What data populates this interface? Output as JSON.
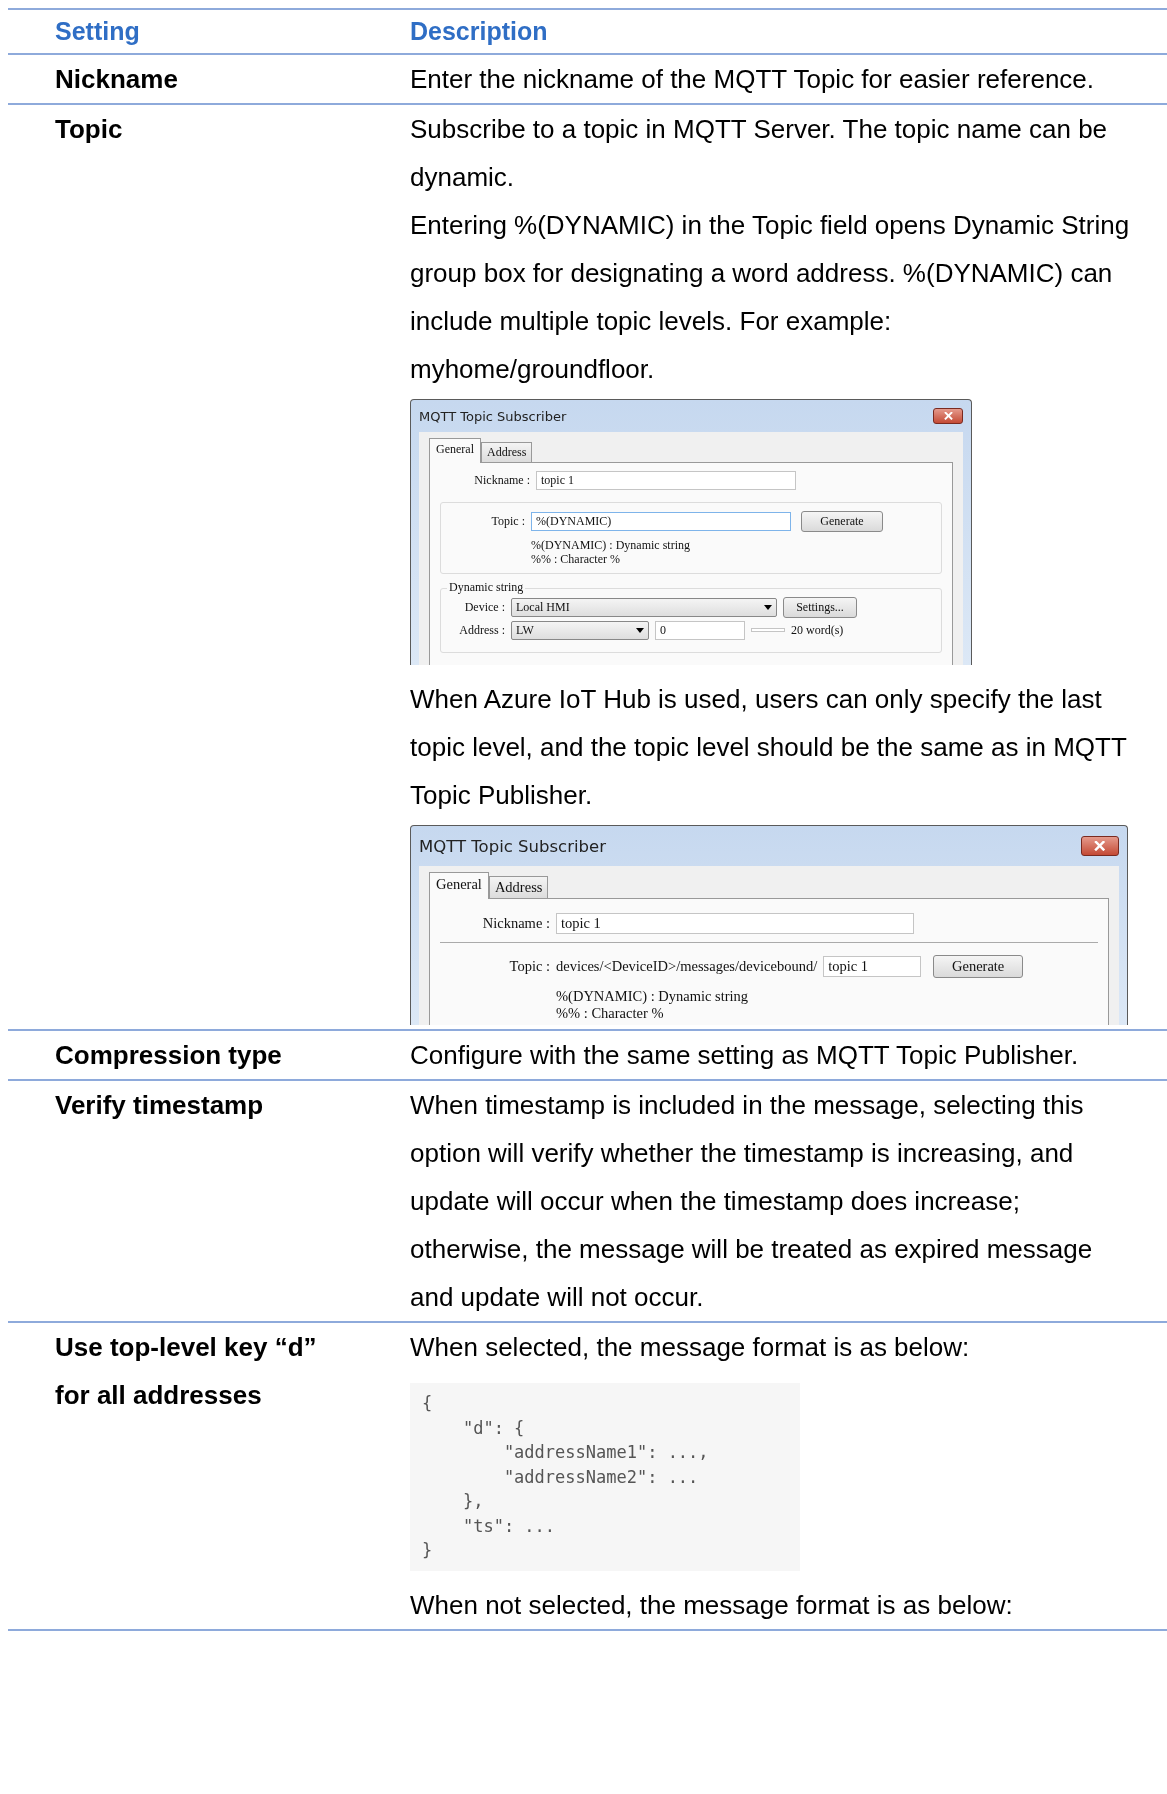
{
  "table": {
    "columns": [
      "Setting",
      "Description"
    ],
    "rows": [
      {
        "setting": "Nickname",
        "content": [
          {
            "kind": "text",
            "text": "Enter the nickname of the MQTT Topic for easier reference."
          }
        ]
      },
      {
        "setting": "Topic",
        "content": [
          {
            "kind": "text",
            "text": "Subscribe to a topic in MQTT Server. The topic name can be dynamic."
          },
          {
            "kind": "text",
            "text": "Entering %(DYNAMIC) in the Topic field opens Dynamic String group box for designating a word address. %(DYNAMIC) can include multiple topic levels. For example: myhome/groundfloor."
          },
          {
            "kind": "dialog",
            "title": "MQTT Topic Subscriber",
            "tabs": [
              {
                "label": "General",
                "selected": true
              },
              {
                "label": "Address",
                "selected": false
              }
            ],
            "nickname_label": "Nickname :",
            "nickname_value": "topic 1",
            "topic_label": "Topic :",
            "topic_value": "%(DYNAMIC)",
            "generate_button": "Generate",
            "hints": [
              "%(DYNAMIC) : Dynamic string",
              "%% : Character %"
            ],
            "dynamic_string": {
              "title": "Dynamic string",
              "device_label": "Device :",
              "device_value": "Local HMI",
              "settings_button": "Settings...",
              "address_label": "Address :",
              "address_type": "LW",
              "address_value": "0",
              "word_count": "20 word(s)"
            }
          },
          {
            "kind": "text",
            "text": "When Azure IoT Hub is used, users can only specify the last topic level, and the topic level should be the same as in MQTT Topic Publisher."
          },
          {
            "kind": "dialog",
            "title": "MQTT Topic Subscriber",
            "tabs": [
              {
                "label": "General",
                "selected": true
              },
              {
                "label": "Address",
                "selected": false
              }
            ],
            "nickname_label": "Nickname :",
            "nickname_value": "topic 1",
            "topic_label": "Topic :",
            "topic_prefix": "devices/<DeviceID>/messages/devicebound/",
            "topic_value": "topic 1",
            "generate_button": "Generate",
            "hints": [
              "%(DYNAMIC) : Dynamic string",
              "%% : Character %"
            ]
          }
        ]
      },
      {
        "setting": "Compression type",
        "content": [
          {
            "kind": "text",
            "text": "Configure with the same setting as MQTT Topic Publisher."
          }
        ]
      },
      {
        "setting": "Verify timestamp",
        "content": [
          {
            "kind": "text",
            "text": "When timestamp is included in the message, selecting this option will verify whether the timestamp is increasing, and update will occur when the timestamp does increase; otherwise, the message will be treated as expired message and update will not occur."
          }
        ]
      },
      {
        "setting": "Use top-level key “d” for all addresses",
        "content": [
          {
            "kind": "text",
            "text": "When selected, the message format is as below:"
          },
          {
            "kind": "code",
            "lines": [
              "{",
              "    \"d\": {",
              "        \"addressName1\": ...,",
              "        \"addressName2\": ...",
              "    },",
              "    \"ts\": ...",
              "}"
            ]
          },
          {
            "kind": "text",
            "text": "When not selected, the message format is as below:"
          }
        ]
      }
    ]
  }
}
